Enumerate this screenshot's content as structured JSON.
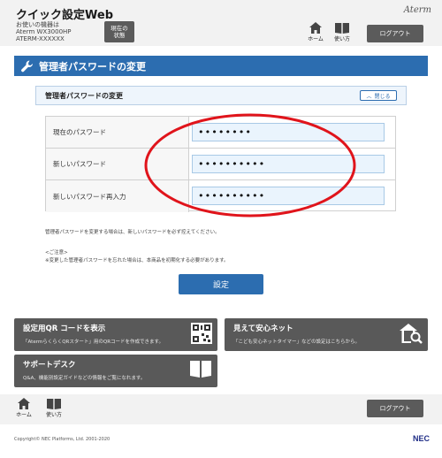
{
  "header": {
    "app_title": "クイック設定Web",
    "device_prefix": "お使いの機器は",
    "device_model": "Aterm WX3000HP",
    "device_serial": "ATERM-XXXXXX",
    "status_button": "現在の\n状態",
    "brand": "Aterm",
    "home_label": "ホーム",
    "manual_label": "使い方",
    "logout_label": "ログアウト"
  },
  "page": {
    "title": "管理者パスワードの変更"
  },
  "section": {
    "title": "管理者パスワードの変更",
    "close_label": "閉じる"
  },
  "form": {
    "rows": [
      {
        "label": "現在のパスワード",
        "value": "••••••••"
      },
      {
        "label": "新しいパスワード",
        "value": "••••••••••"
      },
      {
        "label": "新しいパスワード再入力",
        "value": "••••••••••"
      }
    ]
  },
  "notes": {
    "line1": "管理者パスワードを変更する場合は、新しいパスワードを必ず控えてください。",
    "caution_title": "<ご注意>",
    "caution_text": "※変更した管理者パスワードを忘れた場合は、本商品を初期化する必要があります。"
  },
  "set_button": "設定",
  "cards": [
    {
      "title": "設定用QR コードを表示",
      "desc": "「AtermらくらくQRスタート」用のQRコードを作成できます。"
    },
    {
      "title": "見えて安心ネット",
      "desc": "「こども安心ネットタイマー」などの設定はこちらから。"
    },
    {
      "title": "サポートデスク",
      "desc": "Q&A、機能別設定ガイドなどの情報をご覧になれます。"
    }
  ],
  "footer": {
    "home_label": "ホーム",
    "manual_label": "使い方",
    "logout_label": "ログアウト",
    "copyright": "Copyright© NEC Platforms, Ltd. 2001-2020",
    "nec": "NEC"
  },
  "colors": {
    "accent": "#2c6db0",
    "annotation": "#e0141b",
    "dark_button": "#5b5b5b"
  }
}
